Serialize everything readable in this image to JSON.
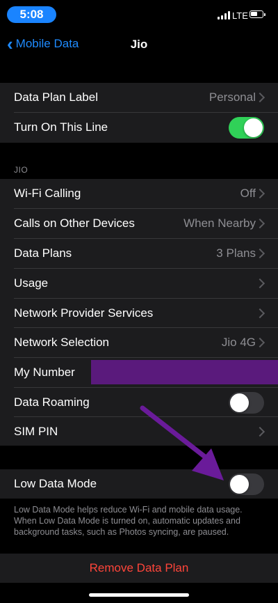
{
  "status_bar": {
    "time": "5:08",
    "network": "LTE"
  },
  "nav": {
    "back_label": "Mobile Data",
    "title": "Jio"
  },
  "group1": {
    "data_plan_label": {
      "label": "Data Plan Label",
      "value": "Personal"
    },
    "turn_on_line": {
      "label": "Turn On This Line",
      "on": true
    }
  },
  "section_header": "JIO",
  "group2": {
    "wifi_calling": {
      "label": "Wi-Fi Calling",
      "value": "Off"
    },
    "calls_other": {
      "label": "Calls on Other Devices",
      "value": "When Nearby"
    },
    "data_plans": {
      "label": "Data Plans",
      "value": "3 Plans"
    },
    "usage": {
      "label": "Usage"
    },
    "provider_services": {
      "label": "Network Provider Services"
    },
    "network_selection": {
      "label": "Network Selection",
      "value": "Jio 4G"
    },
    "my_number": {
      "label": "My Number"
    },
    "data_roaming": {
      "label": "Data Roaming",
      "on": false
    },
    "sim_pin": {
      "label": "SIM PIN"
    }
  },
  "group3": {
    "low_data_mode": {
      "label": "Low Data Mode",
      "on": false
    },
    "footer": "Low Data Mode helps reduce Wi-Fi and mobile data usage. When Low Data Mode is turned on, automatic updates and background tasks, such as Photos syncing, are paused."
  },
  "remove_label": "Remove Data Plan",
  "colors": {
    "accent": "#1f8bff",
    "toggle_on": "#30d158",
    "destructive": "#ff453a",
    "annotation": "#6a1b9a"
  }
}
